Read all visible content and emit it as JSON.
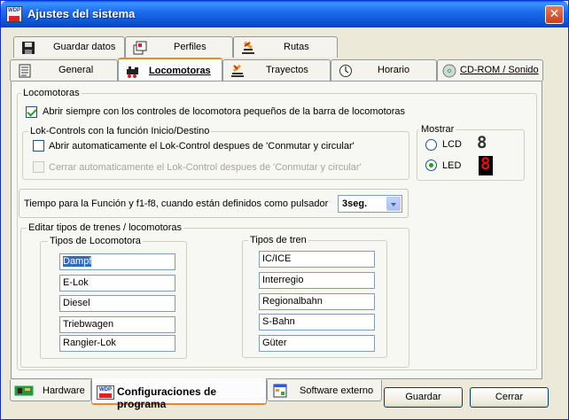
{
  "window": {
    "title": "Ajustes del sistema",
    "close_glyph": "✕",
    "icon_text": "WDP"
  },
  "top_tabs_row1": [
    {
      "label": "Guardar datos",
      "icon": "floppy-icon"
    },
    {
      "label": "Perfiles",
      "icon": "profiles-icon"
    },
    {
      "label": "Rutas",
      "icon": "routes-icon"
    }
  ],
  "top_tabs_row2": [
    {
      "label": "General",
      "icon": "document-icon"
    },
    {
      "label": "Locomotoras",
      "icon": "locomotive-icon",
      "active": true
    },
    {
      "label": "Trayectos",
      "icon": "track-icon"
    },
    {
      "label": "Horario",
      "icon": "clock-icon"
    },
    {
      "label": "CD-ROM / Sonido",
      "icon": "cd-icon"
    }
  ],
  "locomotoras": {
    "legend": "Locomotoras",
    "open_small_controls": {
      "label": "Abrir siempre con los controles de locomotora pequeños de la barra de locomotoras",
      "checked": true
    },
    "lok_controls": {
      "legend": "Lok-Controls con la función Inicio/Destino",
      "auto_open": {
        "label": "Abrir automaticamente el Lok-Control despues de 'Conmutar y circular'",
        "checked": false
      },
      "auto_close": {
        "label": "Cerrar automaticamente el Lok-Control despues de 'Conmutar y circular'",
        "checked": false,
        "disabled": true
      }
    },
    "mostrar": {
      "legend": "Mostrar",
      "options": [
        {
          "label": "LCD",
          "selected": false,
          "digit": "8",
          "color": "#333333"
        },
        {
          "label": "LED",
          "selected": true,
          "digit": "8",
          "color": "#e01010"
        }
      ]
    },
    "function_time": {
      "label": "Tiempo para la Función y f1-f8, cuando están definidos como pulsador",
      "value": "3seg."
    },
    "train_types": {
      "legend": "Editar tipos de trenes / locomotoras",
      "loco_legend": "Tipos de Locomotora",
      "loco_types": [
        "Dampf",
        "E-Lok",
        "Diesel",
        "Triebwagen",
        "Rangier-Lok"
      ],
      "train_legend": "Tipos de tren",
      "train_types": [
        "IC/ICE",
        "Interregio",
        "Regionalbahn",
        "S-Bahn",
        "Güter"
      ]
    }
  },
  "bottom_tabs": [
    {
      "label": "Hardware",
      "icon": "hardware-icon"
    },
    {
      "label": "Configuraciones de programa",
      "icon": "wdp-icon",
      "active": true
    },
    {
      "label": "Software externo",
      "icon": "software-icon"
    }
  ],
  "buttons": {
    "save": "Guardar",
    "close": "Cerrar"
  },
  "colors": {
    "accent": "#e68b2c",
    "titlebar": "#0a5fd9",
    "led": "#e01010"
  }
}
